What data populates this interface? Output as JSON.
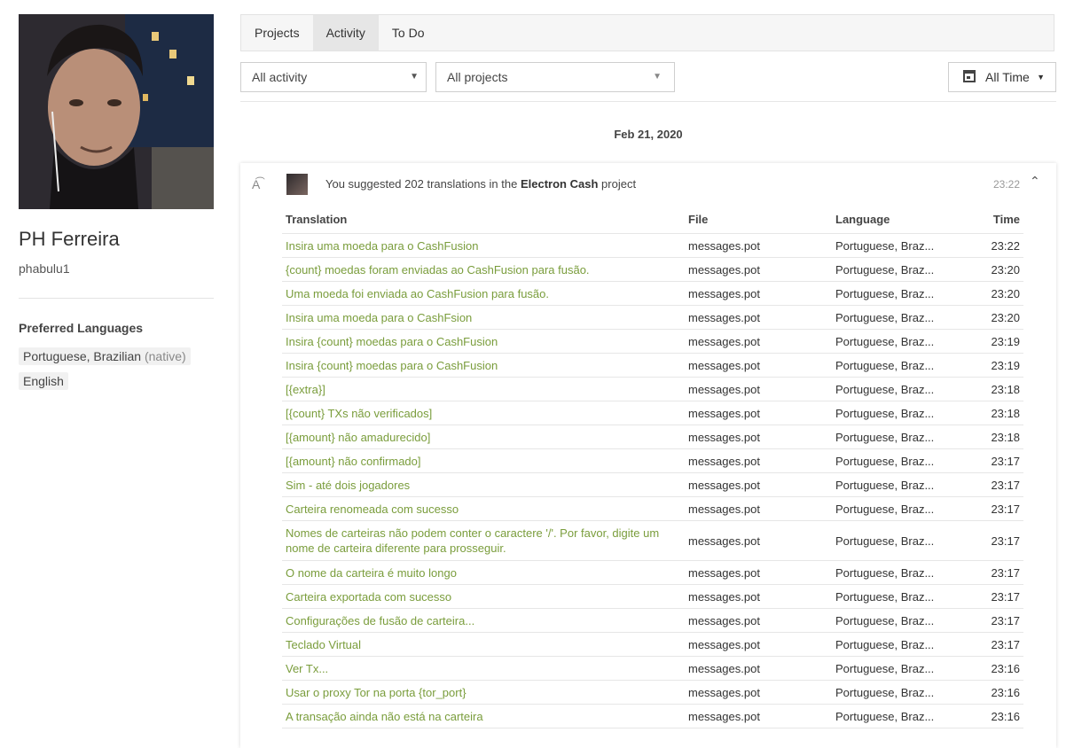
{
  "profile": {
    "name": "PH Ferreira",
    "username": "phabulu1",
    "preferred_languages_title": "Preferred Languages",
    "languages": [
      {
        "name": "Portuguese, Brazilian",
        "note": "(native)"
      },
      {
        "name": "English",
        "note": ""
      }
    ]
  },
  "tabs": [
    "Projects",
    "Activity",
    "To Do"
  ],
  "filters": {
    "activity": "All activity",
    "projects": "All projects",
    "time": "All Time"
  },
  "date_heading": "Feb 21, 2020",
  "activity": {
    "icon": "translate-icon",
    "summary_prefix": "You suggested 202 translations in the",
    "project": "Electron Cash",
    "summary_suffix": "project",
    "time": "23:22",
    "columns": [
      "Translation",
      "File",
      "Language",
      "Time"
    ],
    "rows": [
      {
        "translation": "Insira uma moeda para o CashFusion",
        "file": "messages.pot",
        "language": "Portuguese, Braz...",
        "time": "23:22"
      },
      {
        "translation": "{count} moedas foram enviadas ao CashFusion para fusão.",
        "file": "messages.pot",
        "language": "Portuguese, Braz...",
        "time": "23:20"
      },
      {
        "translation": "Uma moeda foi enviada ao CashFusion para fusão.",
        "file": "messages.pot",
        "language": "Portuguese, Braz...",
        "time": "23:20"
      },
      {
        "translation": "Insira uma moeda para o CashFsion",
        "file": "messages.pot",
        "language": "Portuguese, Braz...",
        "time": "23:20"
      },
      {
        "translation": "Insira {count} moedas para o CashFusion",
        "file": "messages.pot",
        "language": "Portuguese, Braz...",
        "time": "23:19"
      },
      {
        "translation": "Insira {count} moedas para o CashFusion",
        "file": "messages.pot",
        "language": "Portuguese, Braz...",
        "time": "23:19"
      },
      {
        "translation": "[{extra}]",
        "file": "messages.pot",
        "language": "Portuguese, Braz...",
        "time": "23:18"
      },
      {
        "translation": "[{count} TXs não verificados]",
        "file": "messages.pot",
        "language": "Portuguese, Braz...",
        "time": "23:18"
      },
      {
        "translation": "[{amount} não amadurecido]",
        "file": "messages.pot",
        "language": "Portuguese, Braz...",
        "time": "23:18"
      },
      {
        "translation": "[{amount} não confirmado]",
        "file": "messages.pot",
        "language": "Portuguese, Braz...",
        "time": "23:17"
      },
      {
        "translation": "Sim - até dois jogadores",
        "file": "messages.pot",
        "language": "Portuguese, Braz...",
        "time": "23:17"
      },
      {
        "translation": "Carteira renomeada com sucesso",
        "file": "messages.pot",
        "language": "Portuguese, Braz...",
        "time": "23:17"
      },
      {
        "translation": "Nomes de carteiras não podem conter o caractere '/'. Por favor, digite um nome de carteira diferente para prosseguir.",
        "file": "messages.pot",
        "language": "Portuguese, Braz...",
        "time": "23:17"
      },
      {
        "translation": "O nome da carteira é muito longo",
        "file": "messages.pot",
        "language": "Portuguese, Braz...",
        "time": "23:17"
      },
      {
        "translation": "Carteira exportada com sucesso",
        "file": "messages.pot",
        "language": "Portuguese, Braz...",
        "time": "23:17"
      },
      {
        "translation": "Configurações de fusão de carteira...",
        "file": "messages.pot",
        "language": "Portuguese, Braz...",
        "time": "23:17"
      },
      {
        "translation": "Teclado Virtual",
        "file": "messages.pot",
        "language": "Portuguese, Braz...",
        "time": "23:17"
      },
      {
        "translation": "Ver Tx...",
        "file": "messages.pot",
        "language": "Portuguese, Braz...",
        "time": "23:16"
      },
      {
        "translation": "Usar o proxy Tor na porta {tor_port}",
        "file": "messages.pot",
        "language": "Portuguese, Braz...",
        "time": "23:16"
      },
      {
        "translation": "A transação ainda não está na carteira",
        "file": "messages.pot",
        "language": "Portuguese, Braz...",
        "time": "23:16"
      }
    ]
  },
  "colors": {
    "link_green": "#7a9d3c",
    "active_tab": "#e6e6e6"
  }
}
